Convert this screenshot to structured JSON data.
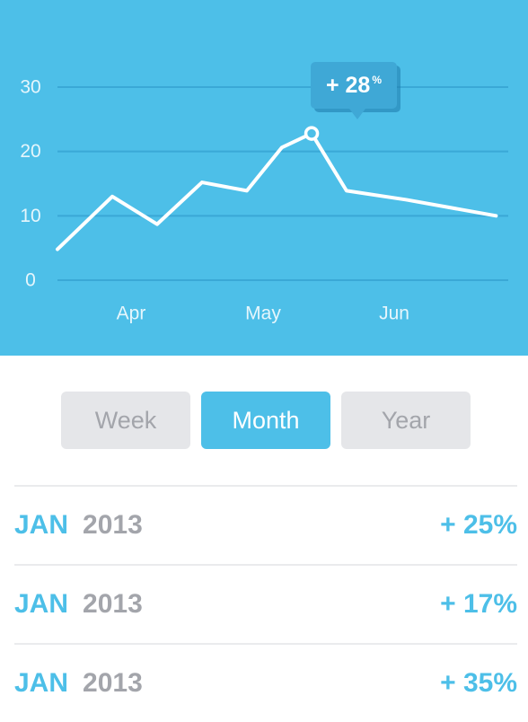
{
  "chart": {
    "tooltip": {
      "value": "+ 28",
      "unit": "%"
    },
    "colors": {
      "background": "#4dbfe8",
      "line": "#ffffff",
      "grid": "#3aa8d6",
      "tooltip": "#3fa8d6"
    }
  },
  "chart_data": {
    "type": "line",
    "title": "",
    "xlabel": "",
    "ylabel": "",
    "ylim": [
      0,
      30
    ],
    "yticks": [
      "0",
      "10",
      "20",
      "30"
    ],
    "xticks": [
      "Apr",
      "May",
      "Jun"
    ],
    "grid": true,
    "series": [
      {
        "x": [
          0.0,
          0.55,
          1.0,
          1.45,
          1.9,
          2.25,
          2.55,
          2.9,
          3.5,
          4.4
        ],
        "y": [
          4.8,
          13.0,
          8.7,
          15.2,
          13.9,
          20.6,
          22.8,
          13.9,
          12.5,
          10.0
        ]
      }
    ],
    "highlight": {
      "index": 6,
      "label": "+ 28%"
    }
  },
  "period_selector": {
    "options": [
      {
        "label": "Week",
        "active": false
      },
      {
        "label": "Month",
        "active": true
      },
      {
        "label": "Year",
        "active": false
      }
    ]
  },
  "list": {
    "rows": [
      {
        "month": "JAN",
        "year": "2013",
        "change": "+ 25%"
      },
      {
        "month": "JAN",
        "year": "2013",
        "change": "+ 17%"
      },
      {
        "month": "JAN",
        "year": "2013",
        "change": "+ 35%"
      }
    ]
  }
}
